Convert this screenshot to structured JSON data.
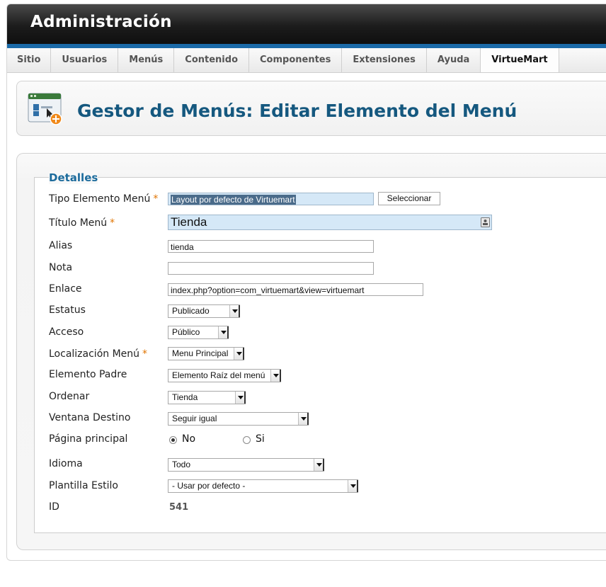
{
  "header": {
    "title": "Administración"
  },
  "menu": {
    "items": [
      {
        "label": "Sitio"
      },
      {
        "label": "Usuarios"
      },
      {
        "label": "Menús"
      },
      {
        "label": "Contenido"
      },
      {
        "label": "Componentes"
      },
      {
        "label": "Extensiones"
      },
      {
        "label": "Ayuda"
      },
      {
        "label": "VirtueMart"
      }
    ],
    "active": "VirtueMart"
  },
  "page": {
    "title": "Gestor de Menús: Editar Elemento del Menú",
    "icon": "menu-edit-icon"
  },
  "form": {
    "legend": "Detalles",
    "tipo": {
      "label": "Tipo Elemento Menú",
      "required": "*",
      "value": "Layout por defecto de Virtuemart",
      "button": "Seleccionar"
    },
    "titulo": {
      "label": "Título Menú",
      "required": "*",
      "value": "Tienda"
    },
    "alias": {
      "label": "Alias",
      "value": "tienda"
    },
    "nota": {
      "label": "Nota",
      "value": ""
    },
    "enlace": {
      "label": "Enlace",
      "value": "index.php?option=com_virtuemart&view=virtuemart"
    },
    "estatus": {
      "label": "Estatus",
      "value": "Publicado"
    },
    "acceso": {
      "label": "Acceso",
      "value": "Público"
    },
    "localizacion": {
      "label": "Localización Menú",
      "required": "*",
      "value": "Menu Principal"
    },
    "padre": {
      "label": "Elemento Padre",
      "value": "Elemento Raíz del menú"
    },
    "ordenar": {
      "label": "Ordenar",
      "value": "Tienda"
    },
    "ventana": {
      "label": "Ventana Destino",
      "value": "Seguir igual"
    },
    "principal": {
      "label": "Página principal",
      "option_no": "No",
      "option_si": "Si",
      "selected": "No"
    },
    "idioma": {
      "label": "Idioma",
      "value": "Todo"
    },
    "plantilla": {
      "label": "Plantilla Estilo",
      "value": "- Usar por defecto -"
    },
    "id": {
      "label": "ID",
      "value": "541"
    }
  },
  "colors": {
    "accent": "#15587f",
    "legend": "#1c6b9c",
    "required": "#e07400",
    "topbar_stripe": "#1b6aa8"
  }
}
